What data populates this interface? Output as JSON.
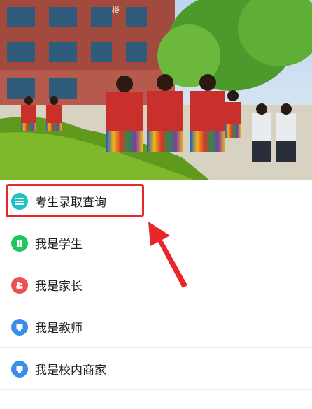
{
  "banner": {
    "sign_text": "楼"
  },
  "menu": {
    "items": [
      {
        "label": "考生录取查询",
        "icon": "list-icon",
        "color": "#1fc3c6"
      },
      {
        "label": "我是学生",
        "icon": "book-icon",
        "color": "#22c55e"
      },
      {
        "label": "我是家长",
        "icon": "family-icon",
        "color": "#ef4f4f"
      },
      {
        "label": "我是教师",
        "icon": "teacher-icon",
        "color": "#3b8de8"
      },
      {
        "label": "我是校内商家",
        "icon": "shop-icon",
        "color": "#3b8de8"
      }
    ]
  },
  "annotation": {
    "highlight_color": "#e8262b"
  }
}
